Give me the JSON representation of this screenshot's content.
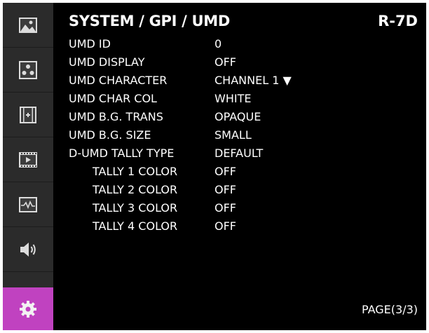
{
  "header": {
    "title": "SYSTEM / GPI / UMD",
    "model": "R-7D"
  },
  "sidebar": {
    "items": [
      {
        "icon": "picture-icon",
        "active": false
      },
      {
        "icon": "color-dots-icon",
        "active": false
      },
      {
        "icon": "marker-icon",
        "active": false
      },
      {
        "icon": "video-frame-icon",
        "active": false
      },
      {
        "icon": "waveform-icon",
        "active": false
      },
      {
        "icon": "speaker-icon",
        "active": false
      },
      {
        "icon": "gear-icon",
        "active": true
      }
    ],
    "active_color": "#c042c0"
  },
  "menu": [
    {
      "label": "UMD ID",
      "value": "0"
    },
    {
      "label": "UMD DISPLAY",
      "value": "OFF"
    },
    {
      "label": "UMD CHARACTER",
      "value": "CHANNEL 1 ▼"
    },
    {
      "label": "UMD CHAR COL",
      "value": "WHITE"
    },
    {
      "label": "UMD B.G. TRANS",
      "value": "OPAQUE"
    },
    {
      "label": "UMD B.G. SIZE",
      "value": "SMALL"
    },
    {
      "label": "D-UMD TALLY TYPE",
      "value": "DEFAULT"
    },
    {
      "label": "TALLY 1 COLOR",
      "value": "OFF"
    },
    {
      "label": "TALLY 2 COLOR",
      "value": "OFF"
    },
    {
      "label": "TALLY 3 COLOR",
      "value": "OFF"
    },
    {
      "label": "TALLY 4 COLOR",
      "value": "OFF"
    }
  ],
  "footer": {
    "page": "PAGE(3/3)"
  }
}
